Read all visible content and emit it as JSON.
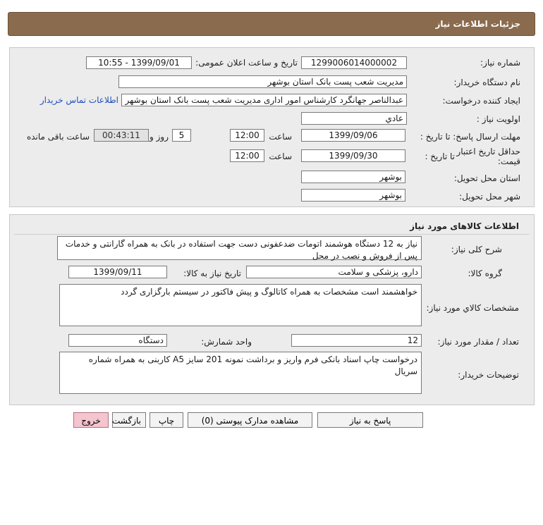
{
  "header": {
    "title": "جزئیات اطلاعات نیاز"
  },
  "need_info": {
    "need_number_label": "شماره نیاز:",
    "need_number": "1299006014000002",
    "announce_label": "تاریخ و ساعت اعلان عمومی:",
    "announce_value": "1399/09/01 - 10:55",
    "buyer_org_label": "نام دستگاه خریدار:",
    "buyer_org": "مدیریت شعب پست بانک استان بوشهر",
    "requester_label": "ایجاد کننده درخواست:",
    "requester": "عبدالناصر  جهانگرد کارشناس امور اداری مدیریت شعب پست بانک استان بوشهر",
    "contact_link": "اطلاعات تماس خریدار",
    "priority_label": "اولویت نیاز :",
    "priority": "عادي",
    "deadline_label": "مهلت ارسال پاسخ:  تا تاریخ :",
    "deadline_date": "1399/09/06",
    "time_label": "ساعت",
    "deadline_time": "12:00",
    "days_count": "5",
    "days_label": "روز و",
    "remaining_time": "00:43:11",
    "remaining_label": "ساعت باقی مانده",
    "validity_label_1": "حداقل تاریخ اعتبار",
    "validity_label_2": "قیمت:",
    "validity_to_label": "تا تاریخ :",
    "validity_date": "1399/09/30",
    "validity_time_label": "ساعت",
    "validity_time": "12:00",
    "province_label": "استان محل تحویل:",
    "province": "بوشهر",
    "city_label": "شهر محل تحویل:",
    "city": "بوشهر"
  },
  "goods": {
    "section_title": "اطلاعات کالاهای مورد نیاز",
    "description_label": "شرح کلی نیاز:",
    "description": "نیاز به 12 دستگاه هوشمند اتومات ضدعفونی دست جهت استفاده در بانک به همراه گارانتی و خدمات پس از فروش و نصب در محل",
    "group_label": "گروه کالا:",
    "group": "دارو، پزشکی و سلامت",
    "need_date_label": "تاریخ نیاز به کالا:",
    "need_date": "1399/09/11",
    "spec_label": "مشخصات کالاي مورد نياز:",
    "spec": "خواهشمند است مشخصات به همراه کاتالوگ و پیش فاکتور در سیستم بارگزاری گردد",
    "qty_label": "تعداد / مقدار مورد نیاز:",
    "qty": "12",
    "unit_label": "واحد شمارش:",
    "unit": "دستگاه",
    "buyer_notes_label": "توضیحات خریدار:",
    "buyer_notes": "درخواست چاپ اسناد بانکی فرم واریز و برداشت نمونه 201 سایز A5 کاربنی به همراه شماره سریال"
  },
  "actions": {
    "respond": "پاسخ به نیاز",
    "attachments": "مشاهده مدارک پیوستی (0)",
    "print": "چاپ",
    "back": "بازگشت",
    "exit": "خروج"
  }
}
